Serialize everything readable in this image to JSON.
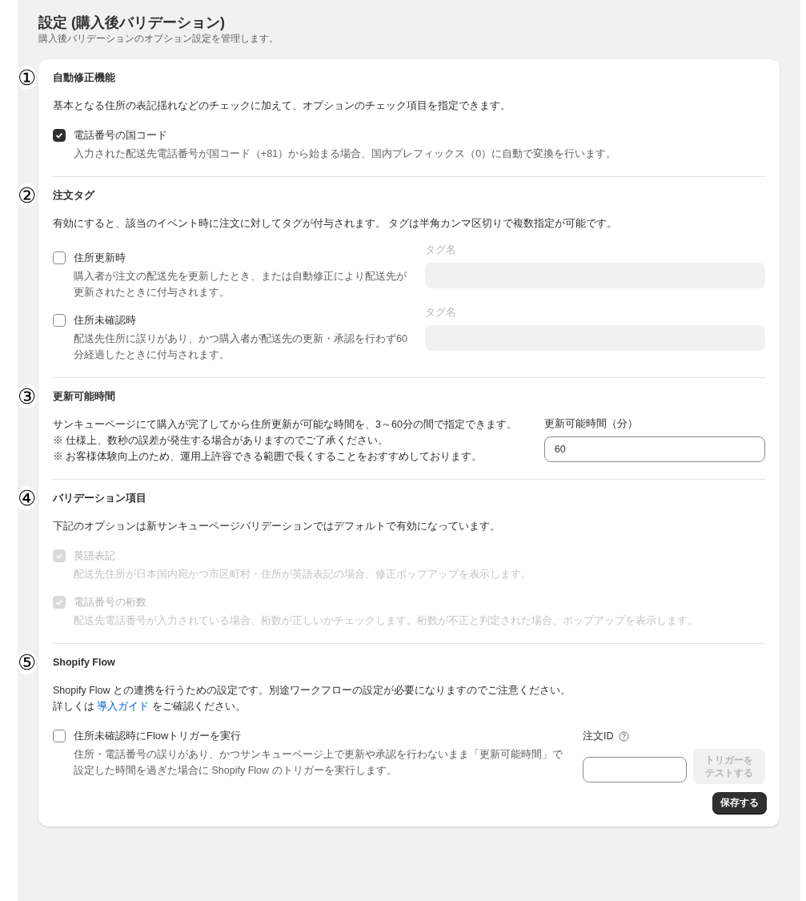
{
  "header": {
    "title": "設定 (購入後バリデーション)",
    "subtitle": "購入後バリデーションのオプション設定を管理します。"
  },
  "sections": [
    {
      "kind": "checks",
      "marker": "①",
      "title": "自動修正機能",
      "description": [
        "基本となる住所の表記揺れなどのチェックに加えて、オプションのチェック項目を指定できます。"
      ],
      "options": [
        {
          "label": "電話番号の国コード",
          "help": "入力された配送先電話番号が国コード（+81）から始まる場合、国内プレフィックス（0）に自動で変換を行います。",
          "checked": true,
          "disabled": false
        }
      ]
    },
    {
      "kind": "tags",
      "marker": "②",
      "title": "注文タグ",
      "description": [
        "有効にすると、該当のイベント時に注文に対してタグが付与されます。 タグは半角カンマ区切りで複数指定が可能です。"
      ],
      "options": [
        {
          "label": "住所更新時",
          "help": "購入者が注文の配送先を更新したとき、または自動修正により配送先が更新されたときに付与されます。",
          "checked": false,
          "disabled": false,
          "field_label": "タグ名"
        },
        {
          "label": "住所未確認時",
          "help": "配送先住所に誤りがあり、かつ購入者が配送先の更新・承認を行わず60分経過したときに付与されます。",
          "checked": false,
          "disabled": false,
          "field_label": "タグ名"
        }
      ]
    },
    {
      "kind": "time",
      "marker": "③",
      "title": "更新可能時間",
      "description": [
        "サンキューページにて購入が完了してから住所更新が可能な時間を、3～60分の間で指定できます。",
        "※ 仕様上、数秒の誤差が発生する場合がありますのでご了承ください。",
        "※ お客様体験向上のため、運用上許容できる範囲で長くすることをおすすめしております。"
      ],
      "field_label": "更新可能時間（分）",
      "value": "60"
    },
    {
      "kind": "checks",
      "marker": "④",
      "title": "バリデーション項目",
      "description": [
        "下記のオプションは新サンキューページバリデーションではデフォルトで有効になっています。"
      ],
      "options": [
        {
          "label": "英語表記",
          "help": "配送先住所が日本国内宛かつ市区町村・住所が英語表記の場合、修正ポップアップを表示します。",
          "checked": true,
          "disabled": true
        },
        {
          "label": "電話番号の桁数",
          "help": "配送先電話番号が入力されている場合、桁数が正しいかチェックします。桁数が不正と判定された場合、ポップアップを表示します。",
          "checked": true,
          "disabled": true
        }
      ]
    },
    {
      "kind": "flow",
      "marker": "⑤",
      "title": "Shopify Flow",
      "description": [
        "Shopify Flow との連携を行うための設定です。別途ワークフローの設定が必要になりますのでご注意ください。"
      ],
      "guide": {
        "before": "詳しくは ",
        "link": "導入ガイド",
        "after": " をご確認ください。"
      },
      "options": [
        {
          "label": "住所未確認時にFlowトリガーを実行",
          "help": "住所・電話番号の誤りがあり、かつサンキューページ上で更新や承認を行わないまま「更新可能時間」で設定した時間を過ぎた場合に Shopify Flow のトリガーを実行します。",
          "checked": false,
          "disabled": false
        }
      ],
      "field_label": "注文ID",
      "test_button": {
        "lines": [
          "トリガーを",
          "テストする"
        ],
        "disabled": true
      }
    }
  ],
  "save_button": "保存する"
}
